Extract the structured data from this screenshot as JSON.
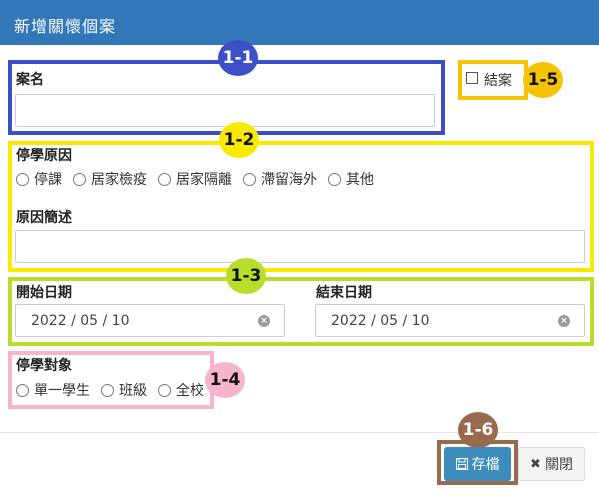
{
  "dialog": {
    "title": "新增關懷個案"
  },
  "case_name": {
    "label": "案名",
    "value": ""
  },
  "closed_checkbox": {
    "label": "結案",
    "checked": false
  },
  "suspension_reason": {
    "label": "停學原因",
    "options": [
      "停課",
      "居家檢疫",
      "居家隔離",
      "滯留海外",
      "其他"
    ]
  },
  "reason_description": {
    "label": "原因簡述",
    "value": ""
  },
  "start_date": {
    "label": "開始日期",
    "value": "2022 / 05 / 10"
  },
  "end_date": {
    "label": "結束日期",
    "value": "2022 / 05 / 10"
  },
  "suspension_target": {
    "label": "停學對象",
    "options": [
      "單一學生",
      "班級",
      "全校"
    ]
  },
  "buttons": {
    "save": "存檔",
    "close": "關閉"
  },
  "annotations": {
    "b1": "1-1",
    "b2": "1-2",
    "b3": "1-3",
    "b4": "1-4",
    "b5": "1-5",
    "b6": "1-6"
  },
  "colors": {
    "header": "#3278b8",
    "box_1_1": "#3d4fc6",
    "box_1_2": "#f7ea00",
    "box_1_3": "#b8de2a",
    "box_1_4": "#f6b4cf",
    "box_1_5": "#f5c400",
    "box_1_6": "#9a6a4e"
  }
}
